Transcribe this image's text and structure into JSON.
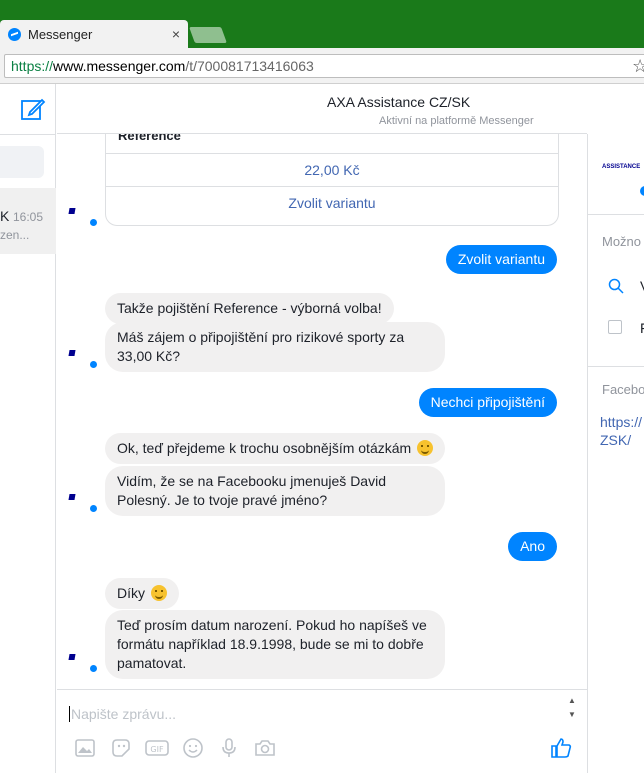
{
  "browser": {
    "tab_title": "Messenger",
    "tab_close": "×",
    "url_scheme": "https://",
    "url_host": "www.messenger.com",
    "url_path": "/t/700081713416063",
    "star": "☆"
  },
  "left_panel": {
    "conversation_initial": "K",
    "conversation_time": "16:05",
    "conversation_preview": "zen..."
  },
  "header": {
    "name": "AXA Assistance CZ/SK",
    "status": "Aktivní na platformě Messenger"
  },
  "card": {
    "title": "Reference",
    "price": "22,00 Kč",
    "button": "Zvolit variantu"
  },
  "messages": {
    "out_1": "Zvolit variantu",
    "in_1a": "Takže pojištění Reference - výborná volba!",
    "in_1b": "Máš zájem o připojištění pro rizikové sporty za 33,00 Kč?",
    "out_2": "Nechci připojištění",
    "in_2a": "Ok, teď přejdeme k trochu osobnějším otázkám",
    "in_2b": "Vidím, že se na Facebooku jmenuješ David Polesný. Je to tvoje pravé jméno?",
    "out_3": "Ano",
    "in_3a": "Díky",
    "in_3b": "Teď prosím datum narození. Pokud ho napíšeš ve formátu například 18.9.1998, bude se mi to dobře pamatovat."
  },
  "composer": {
    "placeholder": "Napište zprávu...",
    "gif_label": "GIF"
  },
  "right_panel": {
    "logo_text": "ASSISTANCE",
    "options_label": "Možno",
    "search_option": "V",
    "checkbox_option": "F",
    "facebook_label": "Facebo",
    "link_text": "https://\nZSK/"
  },
  "colors": {
    "accent": "#0084ff",
    "incoming_bubble": "#f1f0f0",
    "browser_green": "#1a7a1a",
    "link": "#4267b2"
  }
}
